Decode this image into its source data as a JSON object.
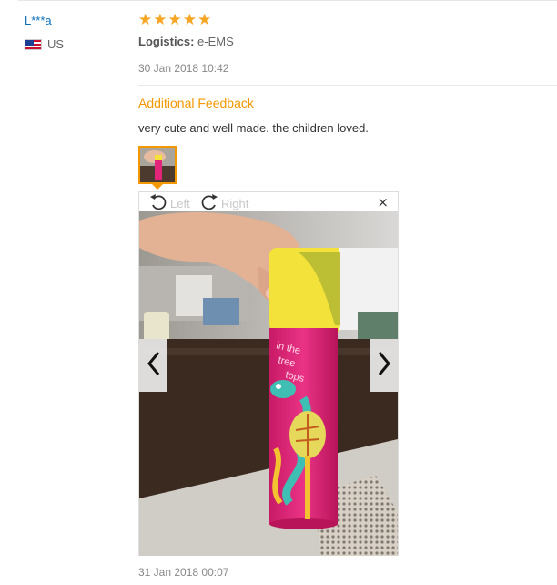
{
  "review": {
    "user": "L***a",
    "country": "US",
    "rating": 5,
    "logistics_label": "Logistics:",
    "logistics_value": "e-EMS",
    "date": "30 Jan 2018 10:42"
  },
  "additional_feedback": {
    "heading": "Additional Feedback",
    "content": "very cute and well made. the children loved.",
    "viewer": {
      "rotate_left_label": "Left",
      "rotate_right_label": "Right",
      "close_glyph": "×",
      "photo_text": "in the tree tops"
    },
    "date": "31 Jan 2018 00:07"
  },
  "icons": {
    "star": "★",
    "flag": "us-flag-icon",
    "rotate_left": "rotate-left-icon",
    "rotate_right": "rotate-right-icon",
    "prev": "chevron-left-icon",
    "next": "chevron-right-icon"
  },
  "colors": {
    "accent": "#f39800",
    "username": "#0b6fb8",
    "star": "#f5a623",
    "tube_pink": "#e2257a",
    "cap_yellow": "#f2e23a"
  }
}
